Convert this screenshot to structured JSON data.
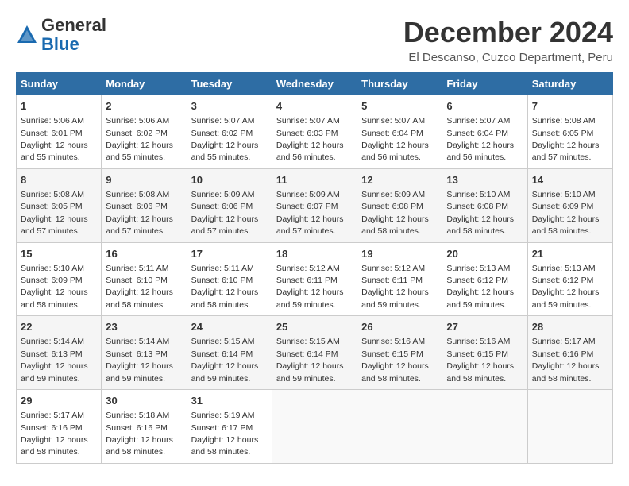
{
  "logo": {
    "general": "General",
    "blue": "Blue"
  },
  "title": "December 2024",
  "location": "El Descanso, Cuzco Department, Peru",
  "days_header": [
    "Sunday",
    "Monday",
    "Tuesday",
    "Wednesday",
    "Thursday",
    "Friday",
    "Saturday"
  ],
  "weeks": [
    [
      {
        "day": "1",
        "sunrise": "Sunrise: 5:06 AM",
        "sunset": "Sunset: 6:01 PM",
        "daylight": "Daylight: 12 hours and 55 minutes."
      },
      {
        "day": "2",
        "sunrise": "Sunrise: 5:06 AM",
        "sunset": "Sunset: 6:02 PM",
        "daylight": "Daylight: 12 hours and 55 minutes."
      },
      {
        "day": "3",
        "sunrise": "Sunrise: 5:07 AM",
        "sunset": "Sunset: 6:02 PM",
        "daylight": "Daylight: 12 hours and 55 minutes."
      },
      {
        "day": "4",
        "sunrise": "Sunrise: 5:07 AM",
        "sunset": "Sunset: 6:03 PM",
        "daylight": "Daylight: 12 hours and 56 minutes."
      },
      {
        "day": "5",
        "sunrise": "Sunrise: 5:07 AM",
        "sunset": "Sunset: 6:04 PM",
        "daylight": "Daylight: 12 hours and 56 minutes."
      },
      {
        "day": "6",
        "sunrise": "Sunrise: 5:07 AM",
        "sunset": "Sunset: 6:04 PM",
        "daylight": "Daylight: 12 hours and 56 minutes."
      },
      {
        "day": "7",
        "sunrise": "Sunrise: 5:08 AM",
        "sunset": "Sunset: 6:05 PM",
        "daylight": "Daylight: 12 hours and 57 minutes."
      }
    ],
    [
      {
        "day": "8",
        "sunrise": "Sunrise: 5:08 AM",
        "sunset": "Sunset: 6:05 PM",
        "daylight": "Daylight: 12 hours and 57 minutes."
      },
      {
        "day": "9",
        "sunrise": "Sunrise: 5:08 AM",
        "sunset": "Sunset: 6:06 PM",
        "daylight": "Daylight: 12 hours and 57 minutes."
      },
      {
        "day": "10",
        "sunrise": "Sunrise: 5:09 AM",
        "sunset": "Sunset: 6:06 PM",
        "daylight": "Daylight: 12 hours and 57 minutes."
      },
      {
        "day": "11",
        "sunrise": "Sunrise: 5:09 AM",
        "sunset": "Sunset: 6:07 PM",
        "daylight": "Daylight: 12 hours and 57 minutes."
      },
      {
        "day": "12",
        "sunrise": "Sunrise: 5:09 AM",
        "sunset": "Sunset: 6:08 PM",
        "daylight": "Daylight: 12 hours and 58 minutes."
      },
      {
        "day": "13",
        "sunrise": "Sunrise: 5:10 AM",
        "sunset": "Sunset: 6:08 PM",
        "daylight": "Daylight: 12 hours and 58 minutes."
      },
      {
        "day": "14",
        "sunrise": "Sunrise: 5:10 AM",
        "sunset": "Sunset: 6:09 PM",
        "daylight": "Daylight: 12 hours and 58 minutes."
      }
    ],
    [
      {
        "day": "15",
        "sunrise": "Sunrise: 5:10 AM",
        "sunset": "Sunset: 6:09 PM",
        "daylight": "Daylight: 12 hours and 58 minutes."
      },
      {
        "day": "16",
        "sunrise": "Sunrise: 5:11 AM",
        "sunset": "Sunset: 6:10 PM",
        "daylight": "Daylight: 12 hours and 58 minutes."
      },
      {
        "day": "17",
        "sunrise": "Sunrise: 5:11 AM",
        "sunset": "Sunset: 6:10 PM",
        "daylight": "Daylight: 12 hours and 58 minutes."
      },
      {
        "day": "18",
        "sunrise": "Sunrise: 5:12 AM",
        "sunset": "Sunset: 6:11 PM",
        "daylight": "Daylight: 12 hours and 59 minutes."
      },
      {
        "day": "19",
        "sunrise": "Sunrise: 5:12 AM",
        "sunset": "Sunset: 6:11 PM",
        "daylight": "Daylight: 12 hours and 59 minutes."
      },
      {
        "day": "20",
        "sunrise": "Sunrise: 5:13 AM",
        "sunset": "Sunset: 6:12 PM",
        "daylight": "Daylight: 12 hours and 59 minutes."
      },
      {
        "day": "21",
        "sunrise": "Sunrise: 5:13 AM",
        "sunset": "Sunset: 6:12 PM",
        "daylight": "Daylight: 12 hours and 59 minutes."
      }
    ],
    [
      {
        "day": "22",
        "sunrise": "Sunrise: 5:14 AM",
        "sunset": "Sunset: 6:13 PM",
        "daylight": "Daylight: 12 hours and 59 minutes."
      },
      {
        "day": "23",
        "sunrise": "Sunrise: 5:14 AM",
        "sunset": "Sunset: 6:13 PM",
        "daylight": "Daylight: 12 hours and 59 minutes."
      },
      {
        "day": "24",
        "sunrise": "Sunrise: 5:15 AM",
        "sunset": "Sunset: 6:14 PM",
        "daylight": "Daylight: 12 hours and 59 minutes."
      },
      {
        "day": "25",
        "sunrise": "Sunrise: 5:15 AM",
        "sunset": "Sunset: 6:14 PM",
        "daylight": "Daylight: 12 hours and 59 minutes."
      },
      {
        "day": "26",
        "sunrise": "Sunrise: 5:16 AM",
        "sunset": "Sunset: 6:15 PM",
        "daylight": "Daylight: 12 hours and 58 minutes."
      },
      {
        "day": "27",
        "sunrise": "Sunrise: 5:16 AM",
        "sunset": "Sunset: 6:15 PM",
        "daylight": "Daylight: 12 hours and 58 minutes."
      },
      {
        "day": "28",
        "sunrise": "Sunrise: 5:17 AM",
        "sunset": "Sunset: 6:16 PM",
        "daylight": "Daylight: 12 hours and 58 minutes."
      }
    ],
    [
      {
        "day": "29",
        "sunrise": "Sunrise: 5:17 AM",
        "sunset": "Sunset: 6:16 PM",
        "daylight": "Daylight: 12 hours and 58 minutes."
      },
      {
        "day": "30",
        "sunrise": "Sunrise: 5:18 AM",
        "sunset": "Sunset: 6:16 PM",
        "daylight": "Daylight: 12 hours and 58 minutes."
      },
      {
        "day": "31",
        "sunrise": "Sunrise: 5:19 AM",
        "sunset": "Sunset: 6:17 PM",
        "daylight": "Daylight: 12 hours and 58 minutes."
      },
      null,
      null,
      null,
      null
    ]
  ]
}
